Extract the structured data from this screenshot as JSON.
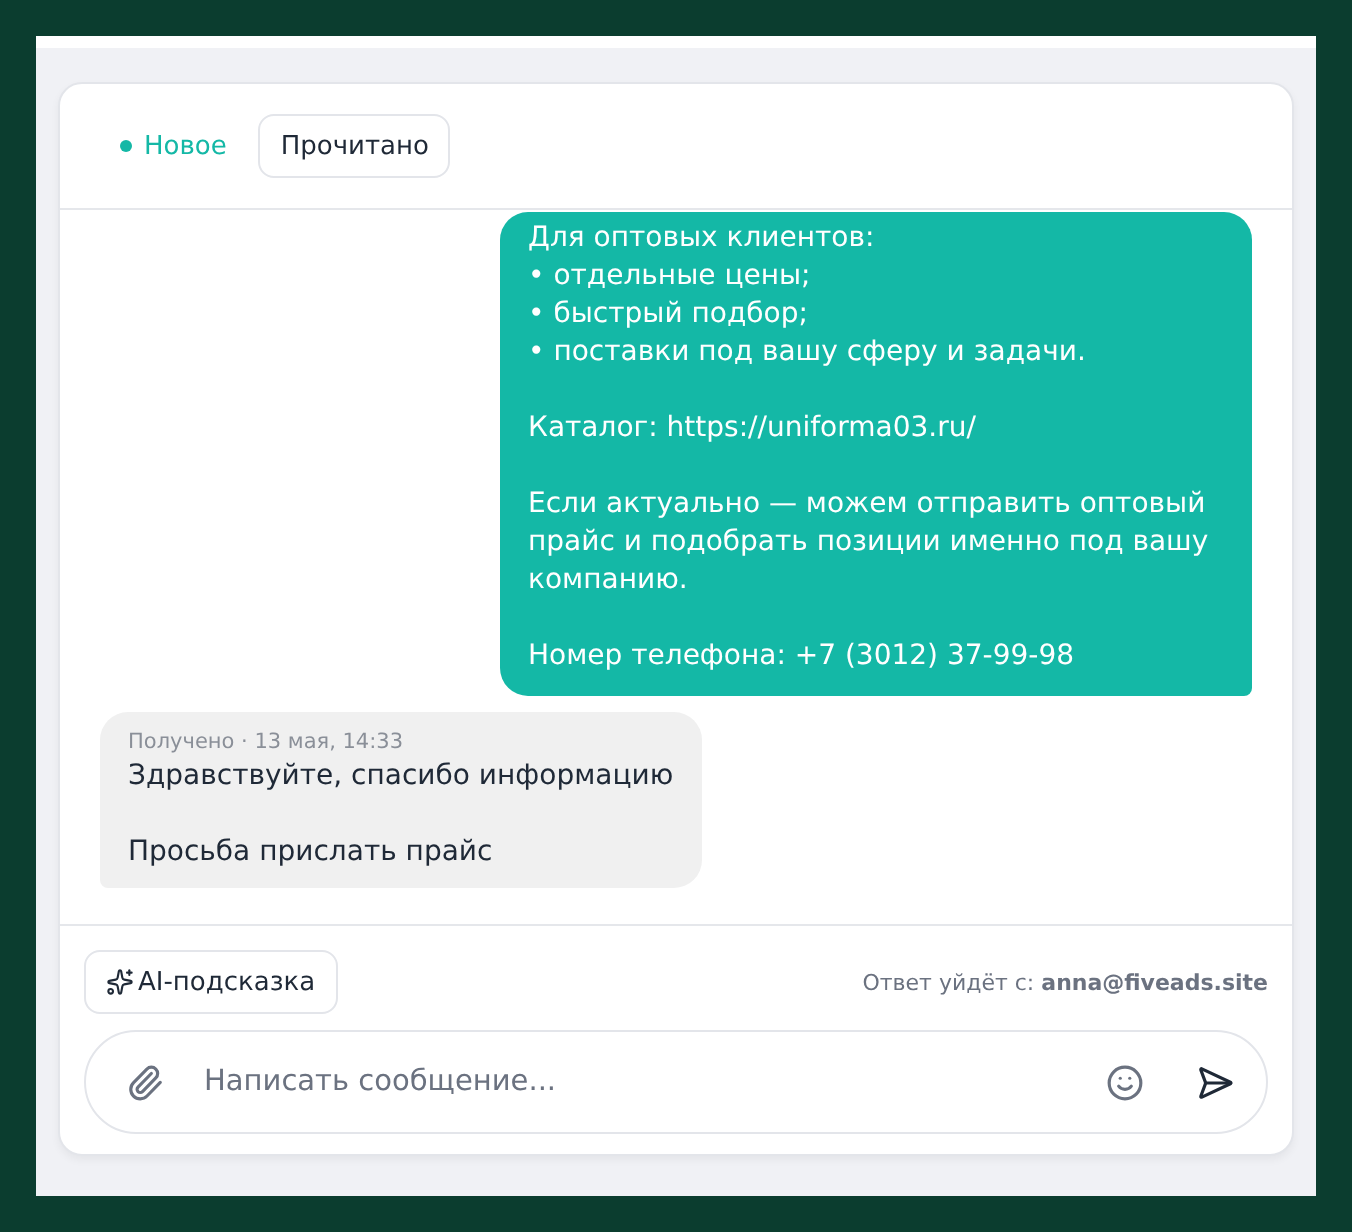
{
  "status": {
    "label": "Новое",
    "color": "#14b8a6"
  },
  "mark_read_button": "Прочитано",
  "messages": [
    {
      "kind": "outgoing",
      "paragraphs": [
        "Для оптовых клиентов:\n• отдельные цены;\n• быстрый подбор;\n• поставки под вашу сферу и задачи.",
        "Каталог: https://uniforma03.ru/",
        "Если актуально — можем отправить оптовый прайс и подобрать позиции именно под вашу компанию.",
        "Номер телефона: +7 (3012) 37-99-98"
      ]
    },
    {
      "kind": "incoming",
      "meta": "Получено · 13 мая, 14:33",
      "paragraphs": [
        "Здравствуйте, спасибо информацию",
        "Просьба прислать прайс"
      ]
    }
  ],
  "ai_button": "AI-подсказка",
  "reply_from": {
    "label": "Ответ уйдёт с:",
    "address": "anna@fiveads.site"
  },
  "composer": {
    "placeholder": "Написать сообщение..."
  }
}
